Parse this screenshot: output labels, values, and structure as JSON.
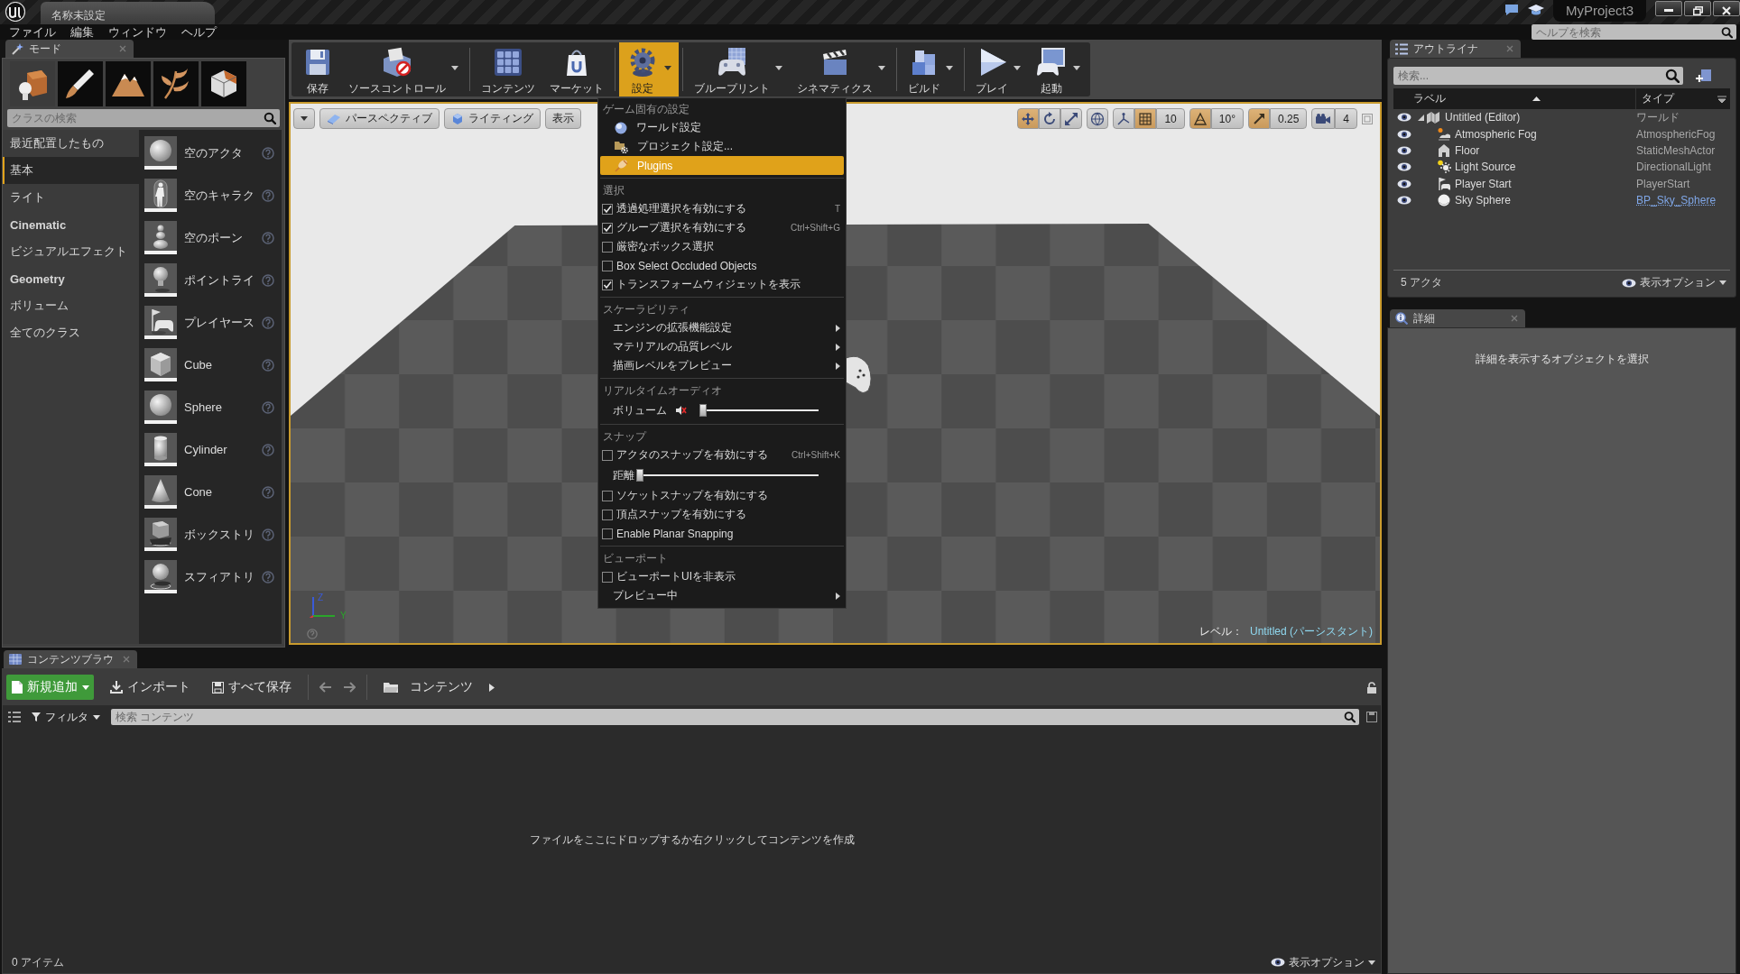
{
  "title_bar": {
    "tab": "名称未設定",
    "project": "MyProject3"
  },
  "menu_bar": {
    "items": [
      "ファイル",
      "編集",
      "ウィンドウ",
      "ヘルプ"
    ],
    "help_search": {
      "placeholder": "ヘルプを検索"
    }
  },
  "modes_panel": {
    "tab": "モード",
    "modes": [
      {
        "kind": "place",
        "selected": true
      },
      {
        "kind": "paint",
        "selected": false
      },
      {
        "kind": "landscape",
        "selected": false
      },
      {
        "kind": "foliage",
        "selected": false
      },
      {
        "kind": "geometry",
        "selected": false
      }
    ],
    "search": {
      "placeholder": "クラスの検索"
    },
    "categories": [
      {
        "label": "最近配置したもの",
        "bold": false,
        "selected": false
      },
      {
        "label": "基本",
        "bold": false,
        "selected": true
      },
      {
        "label": "ライト",
        "bold": false,
        "selected": false
      },
      {
        "label": "Cinematic",
        "bold": true,
        "selected": false
      },
      {
        "label": "ビジュアルエフェクト",
        "bold": false,
        "selected": false
      },
      {
        "label": "Geometry",
        "bold": true,
        "selected": false
      },
      {
        "label": "ボリューム",
        "bold": false,
        "selected": false
      },
      {
        "label": "全てのクラス",
        "bold": false,
        "selected": false
      }
    ],
    "actors": [
      {
        "label": "空のアクタ",
        "kind": "sphere"
      },
      {
        "label": "空のキャラク",
        "kind": "character"
      },
      {
        "label": "空のポーン",
        "kind": "pawn"
      },
      {
        "label": "ポイントライ",
        "kind": "bulb"
      },
      {
        "label": "プレイヤース",
        "kind": "controller"
      },
      {
        "label": "Cube",
        "kind": "cube"
      },
      {
        "label": "Sphere",
        "kind": "sphere"
      },
      {
        "label": "Cylinder",
        "kind": "cylinder"
      },
      {
        "label": "Cone",
        "kind": "cone"
      },
      {
        "label": "ボックストリ",
        "kind": "boxtrigger"
      },
      {
        "label": "スフィアトリ",
        "kind": "spheretrigger"
      }
    ]
  },
  "toolbar": {
    "groups": [
      {
        "buttons": [
          {
            "label": "保存",
            "kind": "save",
            "dropdown": false,
            "selected": false
          },
          {
            "label": "ソースコントロール",
            "kind": "source",
            "dropdown": true,
            "selected": false
          }
        ]
      },
      {
        "buttons": [
          {
            "label": "コンテンツ",
            "kind": "content",
            "dropdown": false,
            "selected": false
          },
          {
            "label": "マーケット",
            "kind": "market",
            "dropdown": false,
            "selected": false
          }
        ]
      },
      {
        "buttons": [
          {
            "label": "設定",
            "kind": "settings",
            "dropdown": true,
            "selected": true
          }
        ]
      },
      {
        "buttons": [
          {
            "label": "ブループリント",
            "kind": "blueprint",
            "dropdown": true,
            "selected": false
          },
          {
            "label": "シネマティクス",
            "kind": "cinematics",
            "dropdown": true,
            "selected": false
          }
        ]
      },
      {
        "buttons": [
          {
            "label": "ビルド",
            "kind": "build",
            "dropdown": true,
            "selected": false
          }
        ]
      },
      {
        "buttons": [
          {
            "label": "プレイ",
            "kind": "play",
            "dropdown": true,
            "selected": false
          },
          {
            "label": "起動",
            "kind": "launch",
            "dropdown": true,
            "selected": false
          }
        ]
      }
    ]
  },
  "settings_menu": {
    "sections": [
      {
        "heading": "ゲーム固有の設定",
        "items": [
          {
            "kind": "globe",
            "label": "ワールド設定",
            "highlighted": false
          },
          {
            "kind": "folder",
            "label": "プロジェクト設定...",
            "highlighted": false
          },
          {
            "kind": "plug",
            "label": "Plugins",
            "highlighted": true
          }
        ]
      },
      {
        "heading": "選択",
        "items": [
          {
            "kind": "check",
            "label": "透過処理選択を有効にする",
            "checked": true,
            "shortcut": "T"
          },
          {
            "kind": "check",
            "label": "グループ選択を有効にする",
            "checked": true,
            "shortcut": "Ctrl+Shift+G"
          },
          {
            "kind": "check",
            "label": "厳密なボックス選択",
            "checked": false
          },
          {
            "kind": "check",
            "label": "Box Select Occluded Objects",
            "checked": false
          },
          {
            "kind": "check",
            "label": "トランスフォームウィジェットを表示",
            "checked": true
          }
        ]
      },
      {
        "heading": "スケーラビリティ",
        "items": [
          {
            "kind": "submenu",
            "label": "エンジンの拡張機能設定"
          },
          {
            "kind": "submenu",
            "label": "マテリアルの品質レベル"
          },
          {
            "kind": "submenu",
            "label": "描画レベルをプレビュー"
          }
        ]
      },
      {
        "heading": "リアルタイムオーディオ",
        "items": [
          {
            "kind": "volume",
            "label": "ボリューム",
            "muted": true,
            "level": 0
          }
        ]
      },
      {
        "heading": "スナップ",
        "items": [
          {
            "kind": "check",
            "label": "アクタのスナップを有効にする",
            "checked": false,
            "shortcut": "Ctrl+Shift+K"
          },
          {
            "kind": "slider",
            "label": "距離",
            "level": 0
          },
          {
            "kind": "check",
            "label": "ソケットスナップを有効にする",
            "checked": false
          },
          {
            "kind": "check",
            "label": "頂点スナップを有効にする",
            "checked": false
          },
          {
            "kind": "check",
            "label": "Enable Planar Snapping",
            "checked": false
          }
        ]
      },
      {
        "heading": "ビューポート",
        "items": [
          {
            "kind": "check",
            "label": "ビューポートUIを非表示",
            "checked": false
          },
          {
            "kind": "submenu",
            "label": "プレビュー中"
          }
        ]
      }
    ]
  },
  "viewport": {
    "left_tools": [
      {
        "kind": "menu"
      },
      {
        "kind": "perspective",
        "label": "パースペクティブ"
      },
      {
        "kind": "lighting",
        "label": "ライティング"
      },
      {
        "kind": "show",
        "label": "表示"
      }
    ],
    "transform": [
      {
        "kind": "move",
        "selected": true
      },
      {
        "kind": "rotate",
        "selected": false
      },
      {
        "kind": "scale",
        "selected": false
      }
    ],
    "snaps": [
      {
        "kind": "grid",
        "on": true,
        "value": "10"
      },
      {
        "kind": "angle",
        "on": true,
        "value": "10°"
      },
      {
        "kind": "scale",
        "on": true,
        "value": "0.25"
      }
    ],
    "camera_speed": "4",
    "axis_labels": [
      "Z",
      "Y"
    ],
    "level_label": "レベル：",
    "level_name": "Untitled (パーシスタント)"
  },
  "outliner": {
    "tab": "アウトライナ",
    "search": {
      "placeholder": "検索..."
    },
    "columns": [
      "ラベル",
      "タイプ"
    ],
    "tree": [
      {
        "label": "Untitled (Editor)",
        "type": "ワールド",
        "kind": "world",
        "visible": true,
        "link": false,
        "expanded": true,
        "children": [
          {
            "label": "Atmospheric Fog",
            "type": "AtmosphericFog",
            "kind": "fog",
            "visible": true,
            "link": false
          },
          {
            "label": "Floor",
            "type": "StaticMeshActor",
            "kind": "mesh",
            "visible": true,
            "link": false
          },
          {
            "label": "Light Source",
            "type": "DirectionalLight",
            "kind": "light",
            "visible": true,
            "link": false
          },
          {
            "label": "Player Start",
            "type": "PlayerStart",
            "kind": "playerstart",
            "visible": true,
            "link": false
          },
          {
            "label": "Sky Sphere",
            "type": "BP_Sky_Sphere",
            "kind": "sky",
            "visible": true,
            "link": true
          }
        ]
      }
    ],
    "count": "5 アクタ",
    "view_options": "表示オプション"
  },
  "details": {
    "tab": "詳細",
    "empty_message": "詳細を表示するオブジェクトを選択"
  },
  "content_browser": {
    "tab": "コンテンツブラウ",
    "add_new": "新規追加",
    "import": "インポート",
    "save_all": "すべて保存",
    "path": [
      "コンテンツ"
    ],
    "filter": "フィルタ",
    "search": {
      "placeholder": "検索 コンテンツ"
    },
    "empty_message": "ファイルをここにドロップするか右クリックしてコンテンツを作成",
    "item_count": "0 アイテム",
    "view_options": "表示オプション"
  }
}
